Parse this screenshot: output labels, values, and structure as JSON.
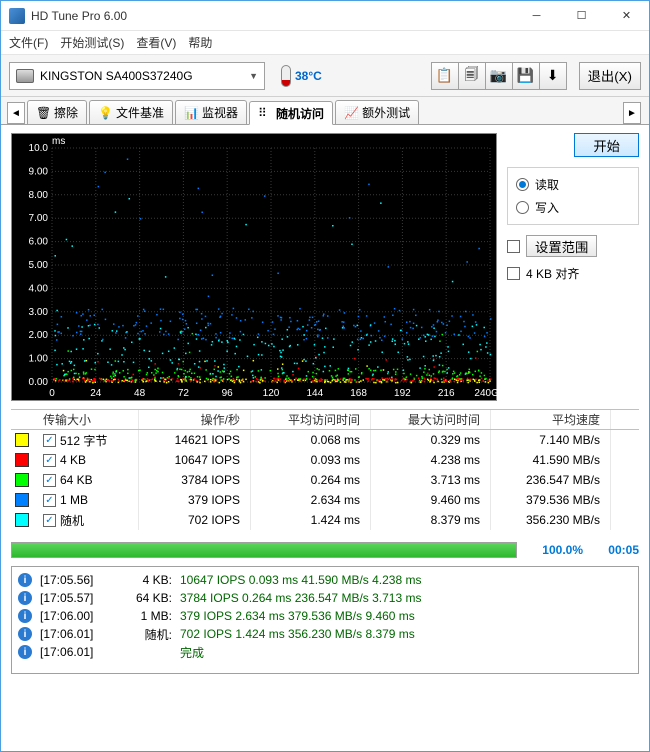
{
  "window": {
    "title": "HD Tune Pro 6.00"
  },
  "menu": {
    "file": "文件(F)",
    "start": "开始测试(S)",
    "view": "查看(V)",
    "help": "帮助"
  },
  "toolbar": {
    "drive": "KINGSTON SA400S37240G",
    "temp": "38°C",
    "exit": "退出(X)"
  },
  "tabs": {
    "erase": "擦除",
    "filebench": "文件基准",
    "monitor": "监视器",
    "random": "随机访问",
    "extra": "额外测试"
  },
  "side": {
    "start": "开始",
    "read": "读取",
    "write": "写入",
    "setrange": "设置范围",
    "align4k": "4 KB 对齐"
  },
  "chart_data": {
    "type": "scatter",
    "xlabel": "GB",
    "ylabel": "ms",
    "xlim": [
      0,
      240
    ],
    "ylim": [
      0,
      10
    ],
    "xticks": [
      0,
      24,
      48,
      72,
      96,
      120,
      144,
      168,
      192,
      216,
      "240GB"
    ],
    "yticks": [
      "0.00",
      "1.00",
      "2.00",
      "3.00",
      "4.00",
      "5.00",
      "6.00",
      "7.00",
      "8.00",
      "9.00",
      "10.0"
    ],
    "series": [
      {
        "name": "512 字节",
        "color": "#ffff00",
        "band": [
          0.0,
          0.15
        ]
      },
      {
        "name": "4 KB",
        "color": "#ff0000",
        "band": [
          0.05,
          0.2
        ]
      },
      {
        "name": "64 KB",
        "color": "#00ff00",
        "band": [
          0.1,
          0.6
        ]
      },
      {
        "name": "1 MB",
        "color": "#0080ff",
        "band": [
          1.8,
          3.2
        ]
      },
      {
        "name": "随机",
        "color": "#00ffff",
        "band": [
          0.2,
          2.5
        ]
      }
    ]
  },
  "table": {
    "headers": {
      "size": "传输大小",
      "ops": "操作/秒",
      "avg": "平均访问时间",
      "max": "最大访问时间",
      "speed": "平均速度"
    },
    "rows": [
      {
        "color": "#ffff00",
        "size": "512 字节",
        "ops": "14621 IOPS",
        "avg": "0.068 ms",
        "max": "0.329 ms",
        "speed": "7.140 MB/s"
      },
      {
        "color": "#ff0000",
        "size": "4 KB",
        "ops": "10647 IOPS",
        "avg": "0.093 ms",
        "max": "4.238 ms",
        "speed": "41.590 MB/s"
      },
      {
        "color": "#00ff00",
        "size": "64 KB",
        "ops": "3784 IOPS",
        "avg": "0.264 ms",
        "max": "3.713 ms",
        "speed": "236.547 MB/s"
      },
      {
        "color": "#0080ff",
        "size": "1 MB",
        "ops": "379 IOPS",
        "avg": "2.634 ms",
        "max": "9.460 ms",
        "speed": "379.536 MB/s"
      },
      {
        "color": "#00ffff",
        "size": "随机",
        "ops": "702 IOPS",
        "avg": "1.424 ms",
        "max": "8.379 ms",
        "speed": "356.230 MB/s"
      }
    ]
  },
  "progress": {
    "pct": "100.0%",
    "time": "00:05"
  },
  "log": [
    {
      "ts": "[17:05.56]",
      "label": "4 KB:",
      "msg": "10647 IOPS 0.093 ms 41.590 MB/s 4.238 ms"
    },
    {
      "ts": "[17:05.57]",
      "label": "64 KB:",
      "msg": "3784 IOPS 0.264 ms 236.547 MB/s 3.713 ms"
    },
    {
      "ts": "[17:06.00]",
      "label": "1 MB:",
      "msg": "379 IOPS 2.634 ms 379.536 MB/s 9.460 ms"
    },
    {
      "ts": "[17:06.01]",
      "label": "随机:",
      "msg": "702 IOPS 1.424 ms 356.230 MB/s 8.379 ms"
    },
    {
      "ts": "[17:06.01]",
      "label": "",
      "msg": "完成"
    }
  ]
}
